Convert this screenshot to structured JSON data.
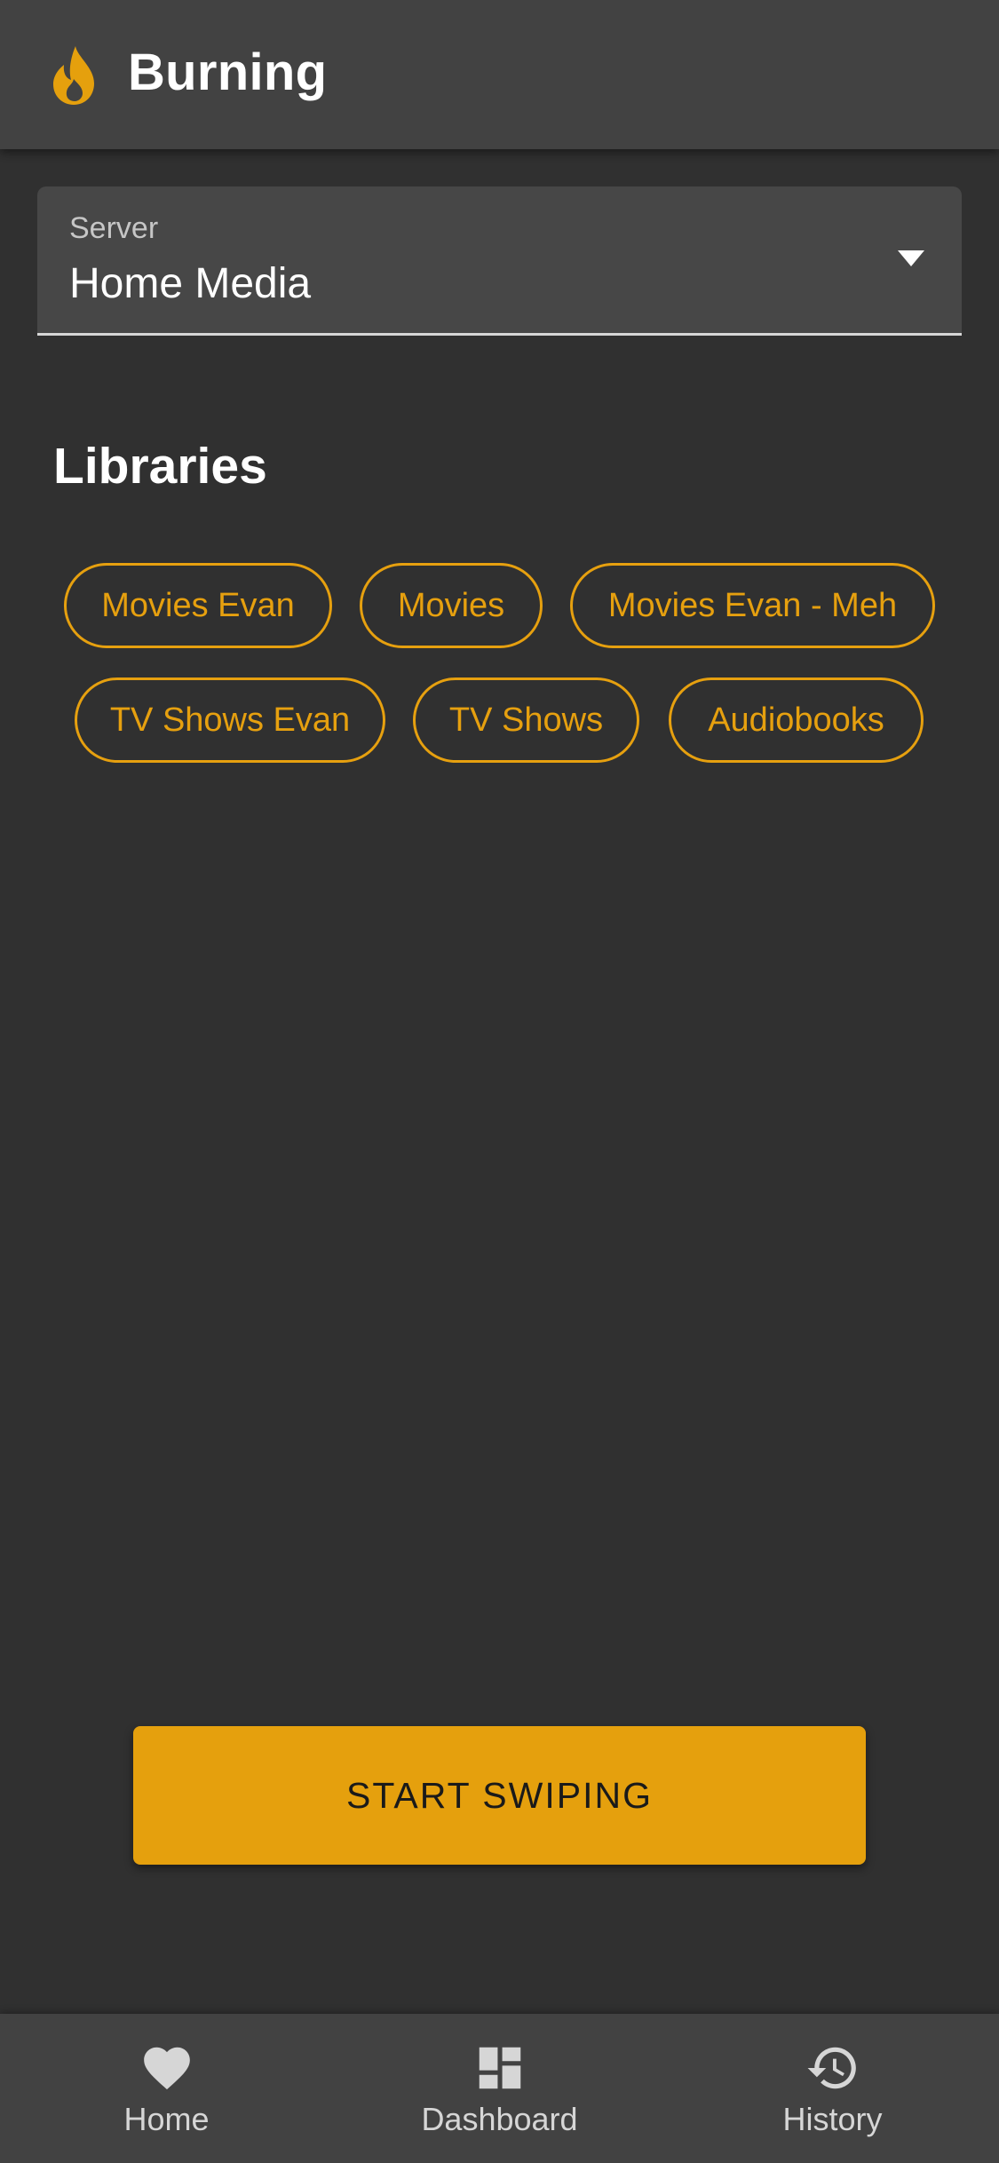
{
  "app_bar": {
    "title": "Burning",
    "logo_icon": "flame-icon"
  },
  "server": {
    "label": "Server",
    "value": "Home Media",
    "icon": "dropdown-arrow-icon"
  },
  "libraries": {
    "title": "Libraries",
    "chips": [
      {
        "label": "Movies Evan"
      },
      {
        "label": "Movies"
      },
      {
        "label": "Movies Evan - Meh"
      },
      {
        "label": "TV Shows Evan"
      },
      {
        "label": "TV Shows"
      },
      {
        "label": "Audiobooks"
      }
    ]
  },
  "start_button": {
    "label": "START SWIPING"
  },
  "bottom_nav": {
    "items": [
      {
        "label": "Home",
        "icon": "heart-icon"
      },
      {
        "label": "Dashboard",
        "icon": "dashboard-icon"
      },
      {
        "label": "History",
        "icon": "history-icon"
      }
    ]
  },
  "colors": {
    "background": "#303030",
    "surface": "#424242",
    "accent": "#e5a00d",
    "text": "#ffffff"
  }
}
